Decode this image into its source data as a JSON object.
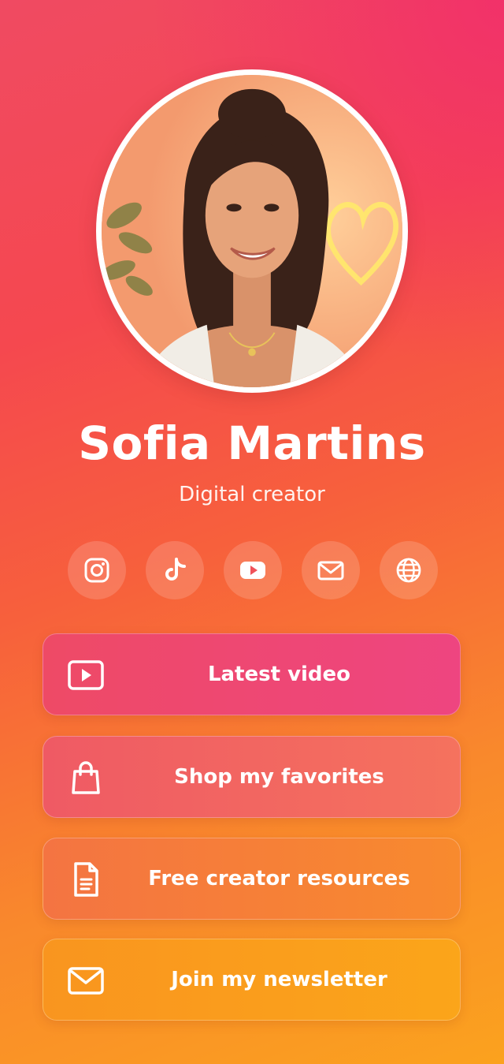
{
  "profile": {
    "name": "Sofia Martins",
    "subtitle": "Digital creator"
  },
  "socials": [
    {
      "icon": "instagram-icon"
    },
    {
      "icon": "tiktok-icon"
    },
    {
      "icon": "youtube-icon"
    },
    {
      "icon": "mail-icon"
    },
    {
      "icon": "globe-icon"
    }
  ],
  "links": [
    {
      "label": "Latest video",
      "icon": "video-play-icon"
    },
    {
      "label": "Shop my favorites",
      "icon": "shopping-bag-icon"
    },
    {
      "label": "Free creator resources",
      "icon": "document-icon"
    },
    {
      "label": "Join my newsletter",
      "icon": "envelope-icon"
    }
  ],
  "colors": {
    "background_top": "#f04a62",
    "background_bottom": "#fba21e",
    "text": "#ffffff"
  }
}
